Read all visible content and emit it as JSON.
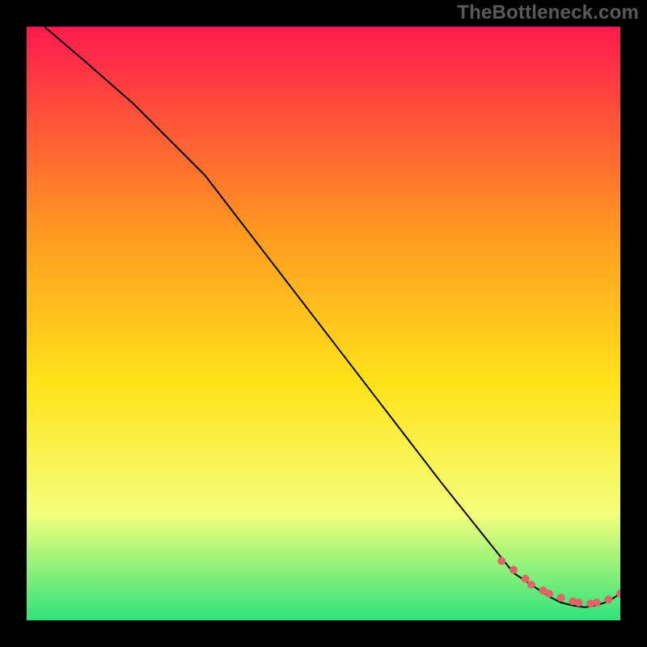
{
  "watermark": "TheBottleneck.com",
  "colors": {
    "page_bg": "#000000",
    "gradient_top": "#ff1a4d",
    "gradient_mid1": "#ff9a1f",
    "gradient_mid2": "#ffe31a",
    "gradient_mid3": "#f4ff7a",
    "gradient_bottom": "#2fe37a",
    "curve": "#000000",
    "markers": "#e06666"
  },
  "chart_data": {
    "type": "line",
    "title": "",
    "xlabel": "",
    "ylabel": "",
    "xlim": [
      0,
      100
    ],
    "ylim": [
      0,
      100
    ],
    "series": [
      {
        "name": "curve",
        "x": [
          3,
          10,
          18,
          25,
          30,
          40,
          50,
          60,
          70,
          78,
          82,
          85,
          88,
          90,
          92,
          94,
          96,
          98,
          100
        ],
        "y": [
          100,
          94,
          87,
          80,
          75,
          62,
          49,
          36,
          23,
          13,
          8,
          6,
          4,
          3,
          2.5,
          2.2,
          2.5,
          3.2,
          4.5
        ]
      }
    ],
    "markers": {
      "name": "cluster",
      "x": [
        80,
        82,
        84,
        85,
        87,
        88,
        90,
        92,
        93,
        95,
        96,
        98,
        100
      ],
      "y": [
        10,
        8.5,
        7,
        6,
        5,
        4.5,
        3.8,
        3.2,
        3,
        2.8,
        3,
        3.5,
        4.5
      ]
    }
  }
}
